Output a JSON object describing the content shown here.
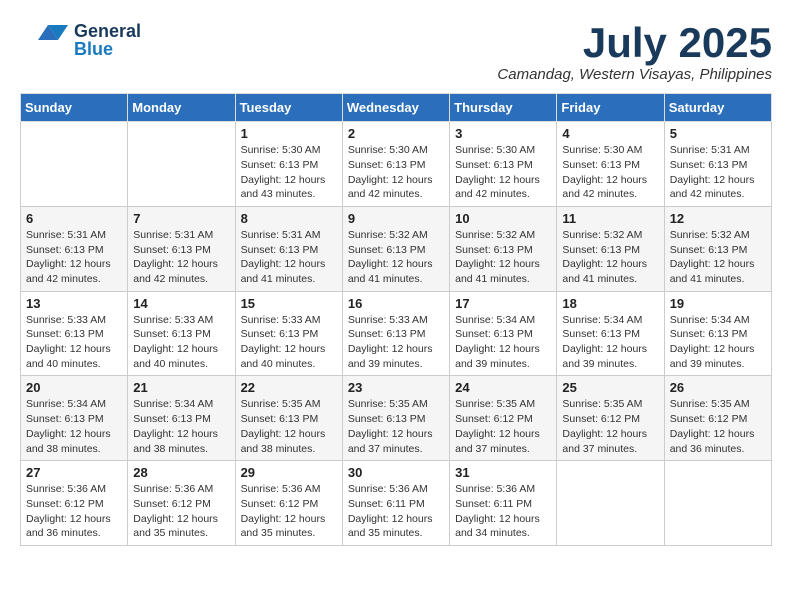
{
  "header": {
    "logo": {
      "line1": "General",
      "line2": "Blue"
    },
    "title": "July 2025",
    "subtitle": "Camandag, Western Visayas, Philippines"
  },
  "days_of_week": [
    "Sunday",
    "Monday",
    "Tuesday",
    "Wednesday",
    "Thursday",
    "Friday",
    "Saturday"
  ],
  "weeks": [
    [
      {
        "day": "",
        "sunrise": "",
        "sunset": "",
        "daylight": ""
      },
      {
        "day": "",
        "sunrise": "",
        "sunset": "",
        "daylight": ""
      },
      {
        "day": "1",
        "sunrise": "Sunrise: 5:30 AM",
        "sunset": "Sunset: 6:13 PM",
        "daylight": "Daylight: 12 hours and 43 minutes."
      },
      {
        "day": "2",
        "sunrise": "Sunrise: 5:30 AM",
        "sunset": "Sunset: 6:13 PM",
        "daylight": "Daylight: 12 hours and 42 minutes."
      },
      {
        "day": "3",
        "sunrise": "Sunrise: 5:30 AM",
        "sunset": "Sunset: 6:13 PM",
        "daylight": "Daylight: 12 hours and 42 minutes."
      },
      {
        "day": "4",
        "sunrise": "Sunrise: 5:30 AM",
        "sunset": "Sunset: 6:13 PM",
        "daylight": "Daylight: 12 hours and 42 minutes."
      },
      {
        "day": "5",
        "sunrise": "Sunrise: 5:31 AM",
        "sunset": "Sunset: 6:13 PM",
        "daylight": "Daylight: 12 hours and 42 minutes."
      }
    ],
    [
      {
        "day": "6",
        "sunrise": "Sunrise: 5:31 AM",
        "sunset": "Sunset: 6:13 PM",
        "daylight": "Daylight: 12 hours and 42 minutes."
      },
      {
        "day": "7",
        "sunrise": "Sunrise: 5:31 AM",
        "sunset": "Sunset: 6:13 PM",
        "daylight": "Daylight: 12 hours and 42 minutes."
      },
      {
        "day": "8",
        "sunrise": "Sunrise: 5:31 AM",
        "sunset": "Sunset: 6:13 PM",
        "daylight": "Daylight: 12 hours and 41 minutes."
      },
      {
        "day": "9",
        "sunrise": "Sunrise: 5:32 AM",
        "sunset": "Sunset: 6:13 PM",
        "daylight": "Daylight: 12 hours and 41 minutes."
      },
      {
        "day": "10",
        "sunrise": "Sunrise: 5:32 AM",
        "sunset": "Sunset: 6:13 PM",
        "daylight": "Daylight: 12 hours and 41 minutes."
      },
      {
        "day": "11",
        "sunrise": "Sunrise: 5:32 AM",
        "sunset": "Sunset: 6:13 PM",
        "daylight": "Daylight: 12 hours and 41 minutes."
      },
      {
        "day": "12",
        "sunrise": "Sunrise: 5:32 AM",
        "sunset": "Sunset: 6:13 PM",
        "daylight": "Daylight: 12 hours and 41 minutes."
      }
    ],
    [
      {
        "day": "13",
        "sunrise": "Sunrise: 5:33 AM",
        "sunset": "Sunset: 6:13 PM",
        "daylight": "Daylight: 12 hours and 40 minutes."
      },
      {
        "day": "14",
        "sunrise": "Sunrise: 5:33 AM",
        "sunset": "Sunset: 6:13 PM",
        "daylight": "Daylight: 12 hours and 40 minutes."
      },
      {
        "day": "15",
        "sunrise": "Sunrise: 5:33 AM",
        "sunset": "Sunset: 6:13 PM",
        "daylight": "Daylight: 12 hours and 40 minutes."
      },
      {
        "day": "16",
        "sunrise": "Sunrise: 5:33 AM",
        "sunset": "Sunset: 6:13 PM",
        "daylight": "Daylight: 12 hours and 39 minutes."
      },
      {
        "day": "17",
        "sunrise": "Sunrise: 5:34 AM",
        "sunset": "Sunset: 6:13 PM",
        "daylight": "Daylight: 12 hours and 39 minutes."
      },
      {
        "day": "18",
        "sunrise": "Sunrise: 5:34 AM",
        "sunset": "Sunset: 6:13 PM",
        "daylight": "Daylight: 12 hours and 39 minutes."
      },
      {
        "day": "19",
        "sunrise": "Sunrise: 5:34 AM",
        "sunset": "Sunset: 6:13 PM",
        "daylight": "Daylight: 12 hours and 39 minutes."
      }
    ],
    [
      {
        "day": "20",
        "sunrise": "Sunrise: 5:34 AM",
        "sunset": "Sunset: 6:13 PM",
        "daylight": "Daylight: 12 hours and 38 minutes."
      },
      {
        "day": "21",
        "sunrise": "Sunrise: 5:34 AM",
        "sunset": "Sunset: 6:13 PM",
        "daylight": "Daylight: 12 hours and 38 minutes."
      },
      {
        "day": "22",
        "sunrise": "Sunrise: 5:35 AM",
        "sunset": "Sunset: 6:13 PM",
        "daylight": "Daylight: 12 hours and 38 minutes."
      },
      {
        "day": "23",
        "sunrise": "Sunrise: 5:35 AM",
        "sunset": "Sunset: 6:13 PM",
        "daylight": "Daylight: 12 hours and 37 minutes."
      },
      {
        "day": "24",
        "sunrise": "Sunrise: 5:35 AM",
        "sunset": "Sunset: 6:12 PM",
        "daylight": "Daylight: 12 hours and 37 minutes."
      },
      {
        "day": "25",
        "sunrise": "Sunrise: 5:35 AM",
        "sunset": "Sunset: 6:12 PM",
        "daylight": "Daylight: 12 hours and 37 minutes."
      },
      {
        "day": "26",
        "sunrise": "Sunrise: 5:35 AM",
        "sunset": "Sunset: 6:12 PM",
        "daylight": "Daylight: 12 hours and 36 minutes."
      }
    ],
    [
      {
        "day": "27",
        "sunrise": "Sunrise: 5:36 AM",
        "sunset": "Sunset: 6:12 PM",
        "daylight": "Daylight: 12 hours and 36 minutes."
      },
      {
        "day": "28",
        "sunrise": "Sunrise: 5:36 AM",
        "sunset": "Sunset: 6:12 PM",
        "daylight": "Daylight: 12 hours and 35 minutes."
      },
      {
        "day": "29",
        "sunrise": "Sunrise: 5:36 AM",
        "sunset": "Sunset: 6:12 PM",
        "daylight": "Daylight: 12 hours and 35 minutes."
      },
      {
        "day": "30",
        "sunrise": "Sunrise: 5:36 AM",
        "sunset": "Sunset: 6:11 PM",
        "daylight": "Daylight: 12 hours and 35 minutes."
      },
      {
        "day": "31",
        "sunrise": "Sunrise: 5:36 AM",
        "sunset": "Sunset: 6:11 PM",
        "daylight": "Daylight: 12 hours and 34 minutes."
      },
      {
        "day": "",
        "sunrise": "",
        "sunset": "",
        "daylight": ""
      },
      {
        "day": "",
        "sunrise": "",
        "sunset": "",
        "daylight": ""
      }
    ]
  ]
}
